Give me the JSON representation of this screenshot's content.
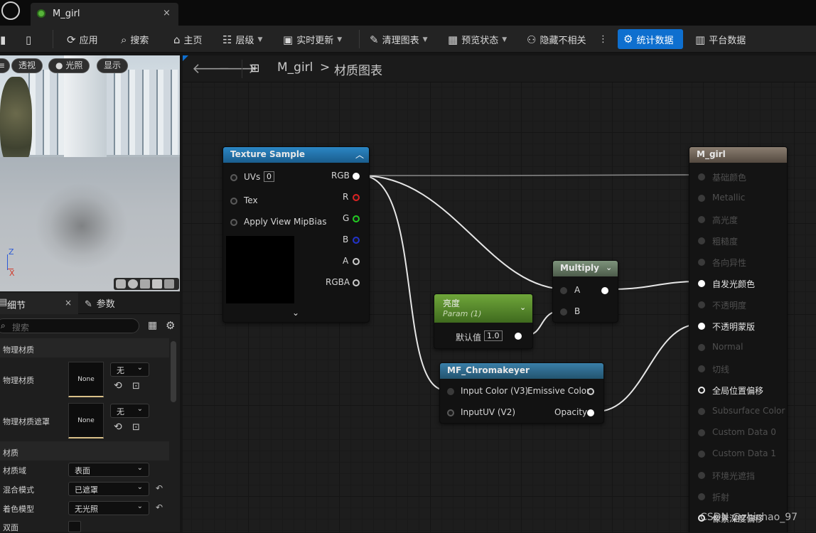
{
  "tab": {
    "title": "M_girl",
    "close": "×"
  },
  "toolbar": {
    "apply": "应用",
    "search": "搜索",
    "home": "主页",
    "hierarchy": "层级",
    "live_update": "实时更新",
    "clean_graph": "清理图表",
    "preview_state": "预览状态",
    "hide_unrelated": "隐藏不相关",
    "stats": "统计数据",
    "platform": "平台数据",
    "more": "⋮"
  },
  "viewport": {
    "menu": "≡",
    "perspective": "透视",
    "lit": "光照",
    "show": "显示",
    "axis_z": "Z",
    "axis_x": "X"
  },
  "panels": {
    "details": "细节",
    "details_close": "×",
    "params": "参数"
  },
  "details": {
    "search_placeholder": "搜索",
    "section_physical": "物理材质",
    "phys_mat_label": "物理材质",
    "phys_mat_thumb": "None",
    "phys_mat_value": "无",
    "phys_mask_label": "物理材质遮罩",
    "phys_mask_thumb": "None",
    "phys_mask_value": "无",
    "section_material": "材质",
    "domain_label": "材质域",
    "domain_value": "表面",
    "blend_label": "混合模式",
    "blend_value": "已遮罩",
    "shading_label": "着色模型",
    "shading_value": "无光照",
    "two_sided_label": "双面"
  },
  "breadcrumb": {
    "asset": "M_girl",
    "separator": ">",
    "graph": "材质图表"
  },
  "nodes": {
    "texture_sample": {
      "title": "Texture Sample",
      "inputs": [
        "UVs",
        "Tex",
        "Apply View MipBias"
      ],
      "uvs_value": "0",
      "outputs": [
        "RGB",
        "R",
        "G",
        "B",
        "A",
        "RGBA"
      ]
    },
    "brightness": {
      "title": "亮度",
      "subtitle": "Param (1)",
      "default_label": "默认值",
      "default_value": "1.0"
    },
    "multiply": {
      "title": "Multiply",
      "inputs": [
        "A",
        "B"
      ]
    },
    "chromakeyer": {
      "title": "MF_Chromakeyer",
      "inputs": [
        "Input Color (V3)",
        "InputUV (V2)"
      ],
      "outputs": [
        "Emissive Color",
        "Opacity"
      ]
    },
    "result": {
      "title": "M_girl",
      "pins": [
        "基础颜色",
        "Metallic",
        "高光度",
        "粗糙度",
        "各向异性",
        "自发光颜色",
        "不透明度",
        "不透明蒙版",
        "Normal",
        "切线",
        "全局位置偏移",
        "Subsurface Color",
        "Custom Data 0",
        "Custom Data 1",
        "环境光遮挡",
        "折射",
        "像素深度偏移"
      ]
    }
  },
  "watermark": "CSDN @zhichao_97",
  "colors": {
    "accent": "#0e6fcf",
    "texture_header": "#1f6fa6",
    "param_header": "#5c8f2b",
    "multiply_header": "#5a6a5a",
    "function_header": "#2f6a8e",
    "result_header": "#6e6458"
  }
}
